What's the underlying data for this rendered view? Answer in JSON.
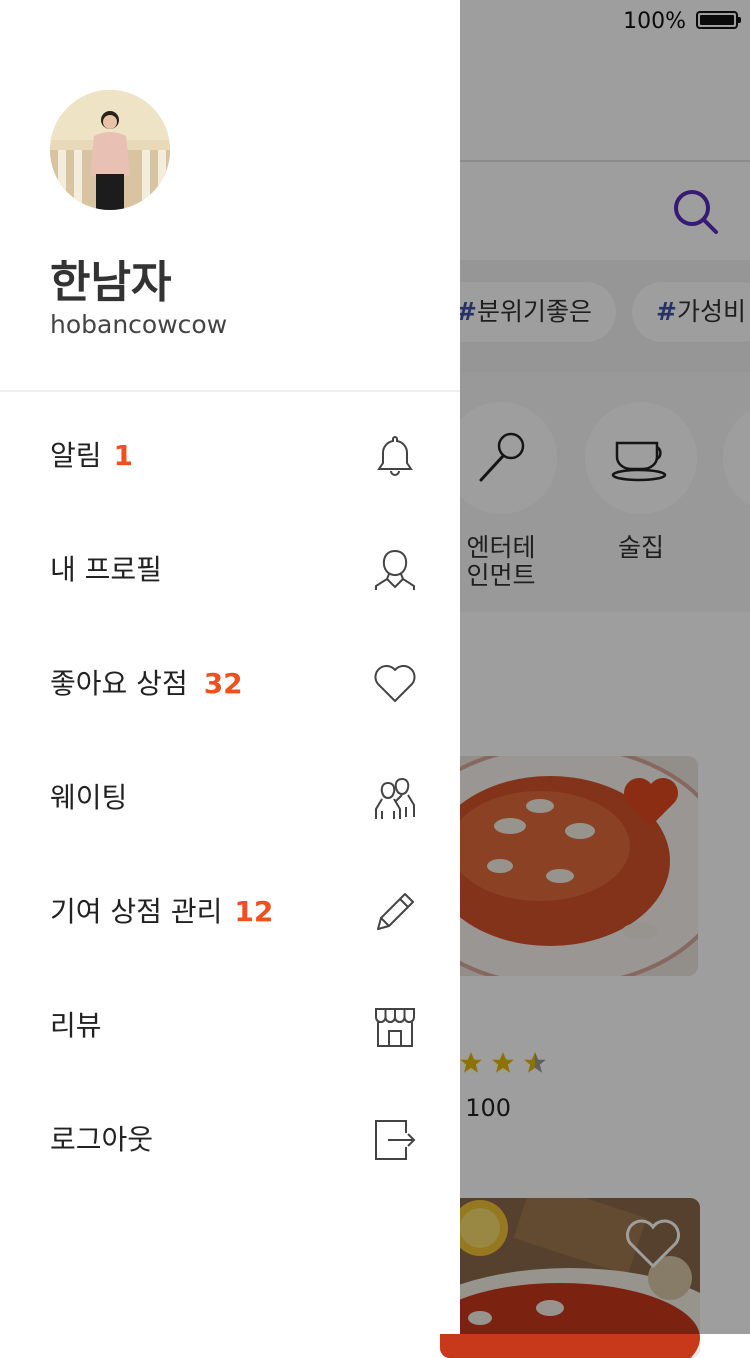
{
  "status_bar": {
    "battery_percent": "100%",
    "battery_level": 1.0
  },
  "background": {
    "tags": [
      "분위기좋은",
      "가성비"
    ],
    "categories": [
      "엔터테\n인먼트",
      "술집"
    ],
    "cards": [
      {
        "liked": true,
        "rating": 2.5,
        "review_count": "100"
      },
      {
        "liked": false
      }
    ]
  },
  "drawer": {
    "profile": {
      "name": "한남자",
      "username": "hobancowcow"
    },
    "menu": [
      {
        "label": "알림",
        "count": "1",
        "icon": "bell-icon"
      },
      {
        "label": "내 프로필",
        "count": "",
        "icon": "person-icon"
      },
      {
        "label": "좋아요 상점",
        "count": "32",
        "icon": "heart-icon"
      },
      {
        "label": "웨이팅",
        "count": "",
        "icon": "people-icon"
      },
      {
        "label": "기여 상점 관리",
        "count": "12",
        "icon": "pencil-icon"
      },
      {
        "label": "리뷰",
        "count": "",
        "icon": "store-icon"
      },
      {
        "label": "로그아웃",
        "count": "",
        "icon": "logout-icon"
      }
    ]
  },
  "colors": {
    "accent": "#f0501e",
    "search_icon": "#5a2bbf",
    "hash": "#3c4fa8",
    "heart_fill": "#e04a1f"
  }
}
